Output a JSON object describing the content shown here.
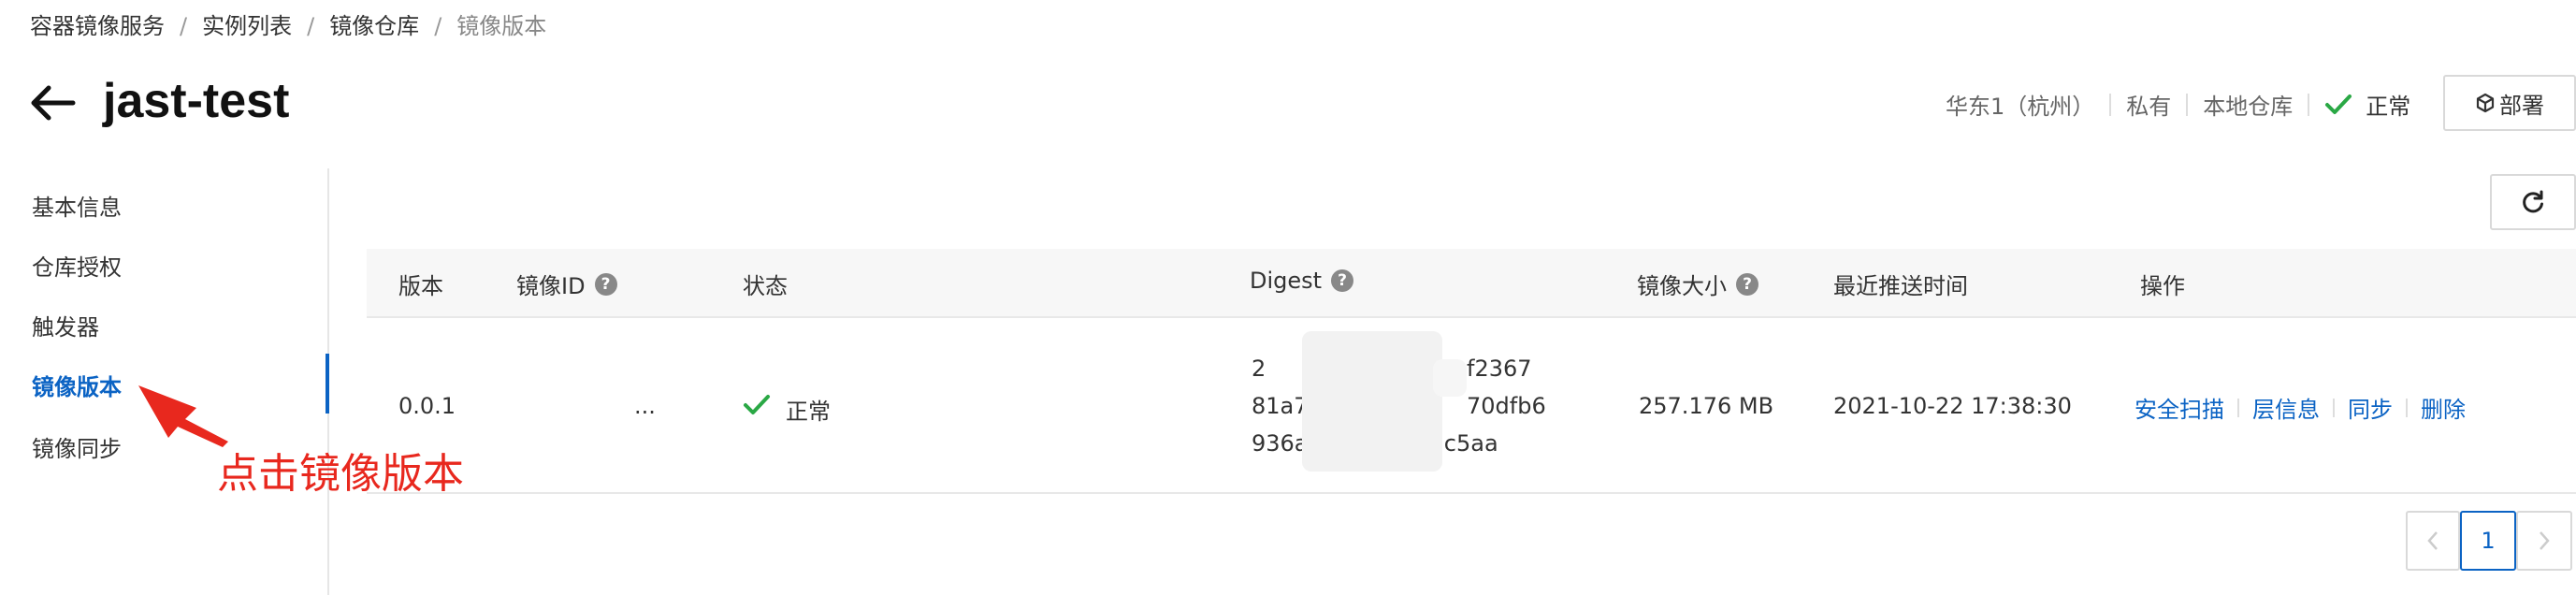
{
  "breadcrumb": {
    "items": [
      "容器镜像服务",
      "实例列表",
      "镜像仓库"
    ],
    "current": "镜像版本",
    "separator": "/"
  },
  "header": {
    "title": "jast-test",
    "region": "华东1（杭州）",
    "visibility": "私有",
    "source": "本地仓库",
    "status": "正常",
    "deploy_label": "部署"
  },
  "sidebar": {
    "items": [
      {
        "label": "基本信息"
      },
      {
        "label": "仓库授权"
      },
      {
        "label": "触发器"
      },
      {
        "label": "镜像版本"
      },
      {
        "label": "镜像同步"
      }
    ],
    "active_index": 3
  },
  "table": {
    "columns": [
      "版本",
      "镜像ID",
      "状态",
      "Digest",
      "镜像大小",
      "最近推送时间",
      "操作"
    ],
    "rows": [
      {
        "version": "0.0.1",
        "image_id": "...",
        "status": "正常",
        "digest_lines": [
          "2",
          "f2367",
          "81a7",
          "70dfb6",
          "936af6",
          "923c5aa"
        ],
        "size": "257.176 MB",
        "pushed": "2021-10-22 17:38:30",
        "actions": [
          "安全扫描",
          "层信息",
          "同步",
          "删除"
        ]
      }
    ]
  },
  "pagination": {
    "current_page": "1"
  },
  "annotation": {
    "text": "点击镜像版本"
  },
  "colors": {
    "accent": "#0b63c4",
    "success": "#2aa845",
    "annotation": "#e8281e"
  }
}
